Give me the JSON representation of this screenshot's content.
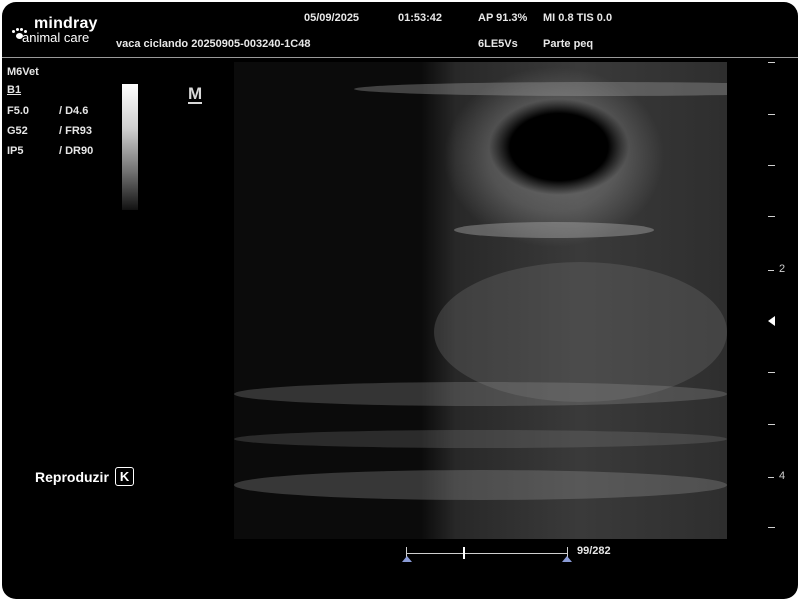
{
  "header": {
    "brand": "mindray",
    "brand_sub": "animal care",
    "date": "05/09/2025",
    "time": "01:53:42",
    "ap": "AP 91.3%",
    "mi_tis": "MI 0.8 TIS 0.0",
    "patient": "vaca ciclando 20250905-003240-1C48",
    "probe": "6LE5Vs",
    "preset": "Parte peq"
  },
  "params": {
    "device": "M6Vet",
    "mode": "B1",
    "f": "F5.0",
    "d": "/ D4.6",
    "g": "G52",
    "fr": "/ FR93",
    "ip": "IP5",
    "dr": "/ DR90"
  },
  "orientation_mark": "M",
  "replay": {
    "label": "Reproduzir",
    "key": "K"
  },
  "depth_scale": {
    "labels": [
      "2",
      "4"
    ]
  },
  "cine": {
    "frame_label": "99/282",
    "current_frame": 99,
    "total_frames": 282
  }
}
